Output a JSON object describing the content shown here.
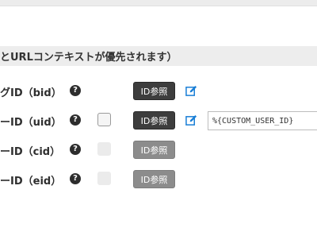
{
  "section": {
    "title": "とURLコンテキストが優先されます）"
  },
  "rows": [
    {
      "label": "グID（bid）",
      "help": "?",
      "button": "ID参照",
      "has_checkbox": false,
      "checkbox_enabled": false,
      "button_enabled": true,
      "has_edit": true,
      "has_input": false
    },
    {
      "label": "ーID（uid）",
      "help": "?",
      "button": "ID参照",
      "has_checkbox": true,
      "checkbox_enabled": true,
      "button_enabled": true,
      "has_edit": true,
      "has_input": true,
      "input_value": "%{CUSTOM_USER_ID}"
    },
    {
      "label": "ーID（cid）",
      "help": "?",
      "button": "ID参照",
      "has_checkbox": true,
      "checkbox_enabled": false,
      "button_enabled": false,
      "has_edit": false,
      "has_input": false
    },
    {
      "label": "ーID（eid）",
      "help": "?",
      "button": "ID参照",
      "has_checkbox": true,
      "checkbox_enabled": false,
      "button_enabled": false,
      "has_edit": false,
      "has_input": false
    }
  ],
  "colors": {
    "edit_icon": "#1a7fd6",
    "button_active": "#3d3d3d",
    "button_disabled": "#8c8c8c"
  },
  "icons": {
    "help": "question-circle",
    "edit": "pencil-square"
  }
}
